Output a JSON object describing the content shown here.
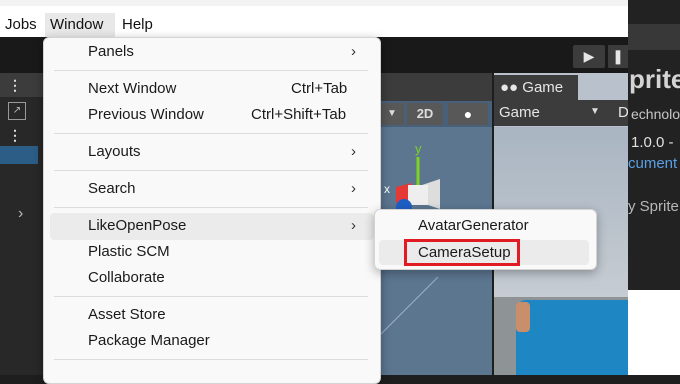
{
  "menubar": {
    "items": [
      "Jobs",
      "Window",
      "Help"
    ]
  },
  "window_menu": {
    "items": [
      {
        "label": "Panels",
        "submenu": true
      },
      {
        "label": "Next Window",
        "shortcut": "Ctrl+Tab"
      },
      {
        "label": "Previous Window",
        "shortcut": "Ctrl+Shift+Tab"
      },
      {
        "label": "Layouts",
        "submenu": true
      },
      {
        "label": "Search",
        "submenu": true
      },
      {
        "label": "LikeOpenPose",
        "submenu": true
      },
      {
        "label": "Plastic SCM"
      },
      {
        "label": "Collaborate"
      },
      {
        "label": "Asset Store"
      },
      {
        "label": "Package Manager"
      }
    ]
  },
  "submenu": {
    "items": [
      "AvatarGenerator",
      "CameraSetup"
    ],
    "highlighted": "CameraSetup"
  },
  "scene": {
    "mode_2d": "2D"
  },
  "game_view": {
    "tab_label": "Game",
    "display_select": "Game",
    "right_cut": "D"
  },
  "package_panel": {
    "title": "prite",
    "vendor": "echnolo",
    "version": "1.0.0 -",
    "doc_link": "cument",
    "by": "y Sprite"
  },
  "colors": {
    "highlight_box": "#e01b24",
    "selection": "#2c5d87"
  }
}
